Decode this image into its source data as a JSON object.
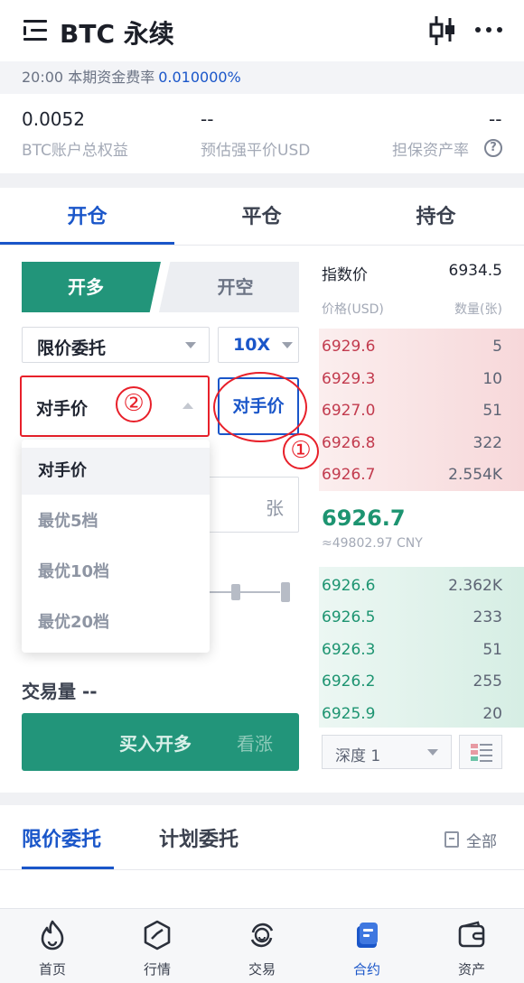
{
  "header": {
    "title": "BTC 永续",
    "menu_icon": "list-menu-icon",
    "chart_icon": "candlestick-icon",
    "more_icon": "more-dots-icon"
  },
  "funding": {
    "label": "20:00 本期资金费率",
    "rate": "0.010000%"
  },
  "stats": [
    {
      "value": "0.0052",
      "label": "BTC账户总权益"
    },
    {
      "value": "--",
      "label": "预估强平价USD"
    },
    {
      "value": "--",
      "label": "担保资产率"
    }
  ],
  "main_tabs": [
    "开仓",
    "平仓",
    "持仓"
  ],
  "side": {
    "long": "开多",
    "short": "开空"
  },
  "order_type": "限价委托",
  "leverage": "10X",
  "price_type": "对手价",
  "counter_button": "对手价",
  "annotations": {
    "one": "①",
    "two": "②"
  },
  "dropdown": [
    "对手价",
    "最优5档",
    "最优10档",
    "最优20档"
  ],
  "quantity_unit": "张",
  "volume": "交易量 --",
  "buy": {
    "main": "买入开多",
    "sub": "看涨"
  },
  "orderbook": {
    "index_label": "指数价",
    "index_value": "6934.5",
    "price_header": "价格(USD)",
    "qty_header": "数量(张)",
    "asks": [
      {
        "price": "6929.6",
        "qty": "5"
      },
      {
        "price": "6929.3",
        "qty": "10"
      },
      {
        "price": "6927.0",
        "qty": "51"
      },
      {
        "price": "6926.8",
        "qty": "322"
      },
      {
        "price": "6926.7",
        "qty": "2.554K"
      }
    ],
    "last": "6926.7",
    "cny": "≈49802.97 CNY",
    "bids": [
      {
        "price": "6926.6",
        "qty": "2.362K"
      },
      {
        "price": "6926.5",
        "qty": "233"
      },
      {
        "price": "6926.3",
        "qty": "51"
      },
      {
        "price": "6926.2",
        "qty": "255"
      },
      {
        "price": "6925.9",
        "qty": "20"
      }
    ],
    "depth": "深度 1"
  },
  "order_tabs": [
    "限价委托",
    "计划委托"
  ],
  "all_label": "全部",
  "nav": [
    {
      "label": "首页",
      "icon": "home-flame-icon"
    },
    {
      "label": "行情",
      "icon": "market-icon"
    },
    {
      "label": "交易",
      "icon": "trade-icon"
    },
    {
      "label": "合约",
      "icon": "contract-icon"
    },
    {
      "label": "资产",
      "icon": "wallet-icon"
    }
  ],
  "colors": {
    "accent": "#1a56c9",
    "buy": "#22957a",
    "sell": "#c23b4e",
    "annotation": "#e8202a"
  }
}
